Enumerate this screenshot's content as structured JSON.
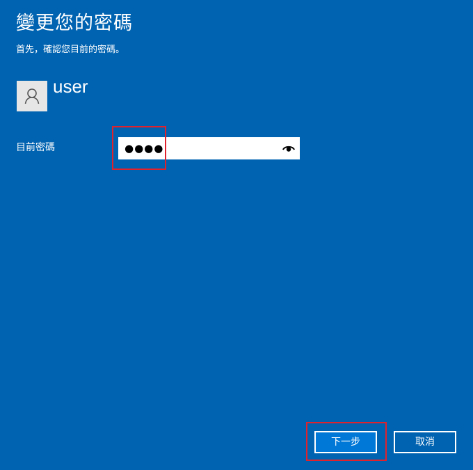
{
  "header": {
    "title": "變更您的密碼",
    "subtitle": "首先，確認您目前的密碼。"
  },
  "account": {
    "avatar_icon": "user-silhouette-icon",
    "username": "user"
  },
  "password_field": {
    "label": "目前密碼",
    "masked_value": "●●●●",
    "reveal_icon": "eye-icon"
  },
  "buttons": {
    "next_label": "下一步",
    "cancel_label": "取消"
  },
  "colors": {
    "background": "#0063b1",
    "primary_button": "#0078d7",
    "highlight": "#e0222d"
  }
}
